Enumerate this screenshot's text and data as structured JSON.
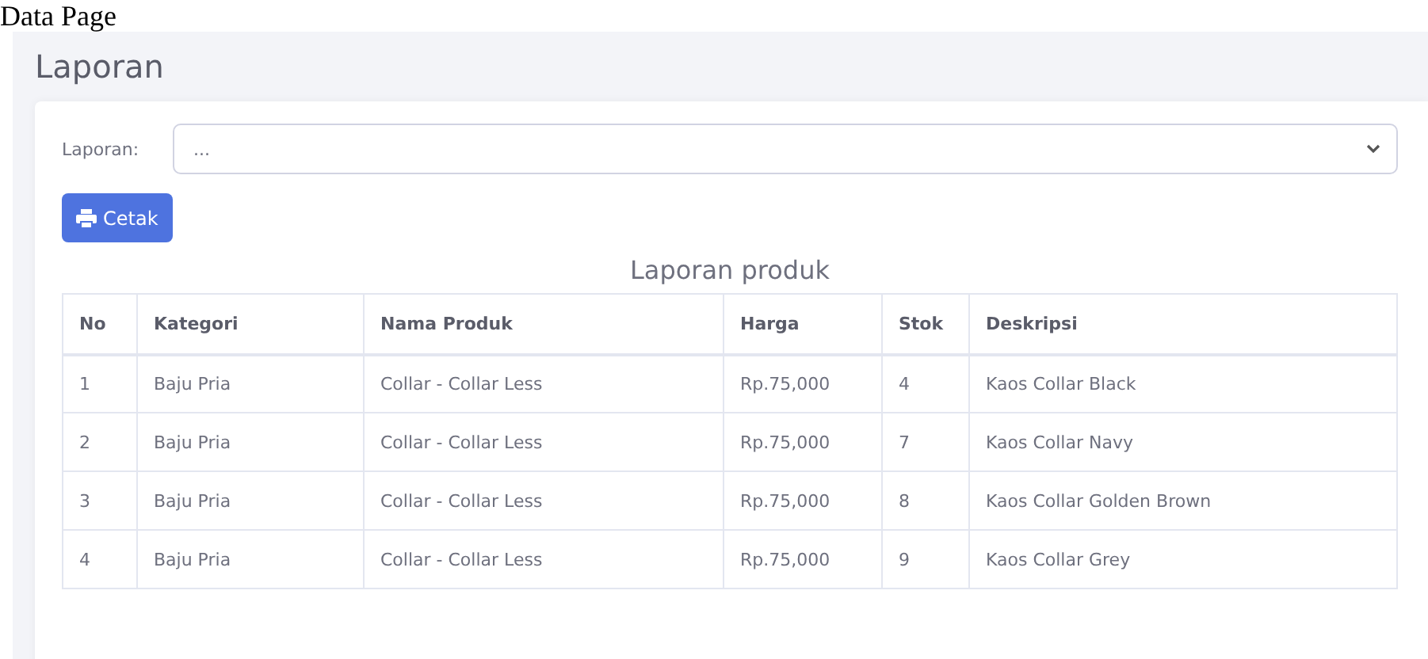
{
  "page_caption": "Data Page",
  "heading": "Laporan",
  "form": {
    "label": "Laporan:",
    "select_value": "...",
    "button": "Cetak"
  },
  "report_title": "Laporan produk",
  "table": {
    "columns": [
      "No",
      "Kategori",
      "Nama Produk",
      "Harga",
      "Stok",
      "Deskripsi"
    ],
    "rows": [
      [
        "1",
        "Baju Pria",
        "Collar - Collar Less",
        "Rp.75,000",
        "4",
        "Kaos Collar Black"
      ],
      [
        "2",
        "Baju Pria",
        "Collar - Collar Less",
        "Rp.75,000",
        "7",
        "Kaos Collar Navy"
      ],
      [
        "3",
        "Baju Pria",
        "Collar - Collar Less",
        "Rp.75,000",
        "8",
        "Kaos Collar Golden Brown"
      ],
      [
        "4",
        "Baju Pria",
        "Collar - Collar Less",
        "Rp.75,000",
        "9",
        "Kaos Collar Grey"
      ]
    ]
  }
}
